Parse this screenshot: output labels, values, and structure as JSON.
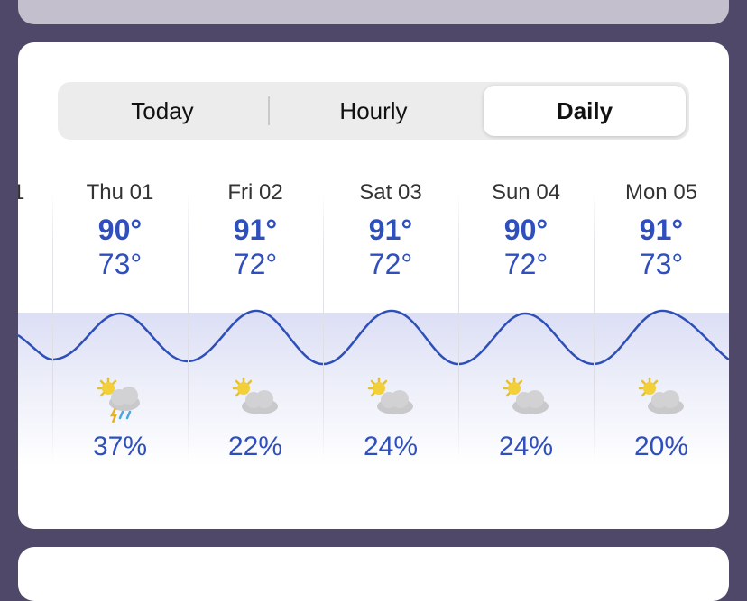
{
  "tabs": [
    {
      "label": "Today",
      "selected": false
    },
    {
      "label": "Hourly",
      "selected": false
    },
    {
      "label": "Daily",
      "selected": true
    }
  ],
  "partial_label": "1",
  "days": [
    {
      "label": "Thu 01",
      "high": "90°",
      "low": "73°",
      "icon": "thunderstorm-icon",
      "precip": "37%"
    },
    {
      "label": "Fri 02",
      "high": "91°",
      "low": "72°",
      "icon": "partly-cloudy-icon",
      "precip": "22%"
    },
    {
      "label": "Sat 03",
      "high": "91°",
      "low": "72°",
      "icon": "partly-cloudy-icon",
      "precip": "24%"
    },
    {
      "label": "Sun 04",
      "high": "90°",
      "low": "72°",
      "icon": "partly-cloudy-icon",
      "precip": "24%"
    },
    {
      "label": "Mon 05",
      "high": "91°",
      "low": "73°",
      "icon": "partly-cloudy-icon",
      "precip": "20%"
    }
  ],
  "colors": {
    "accent": "#2f4fbf",
    "background": "#4f4868"
  }
}
